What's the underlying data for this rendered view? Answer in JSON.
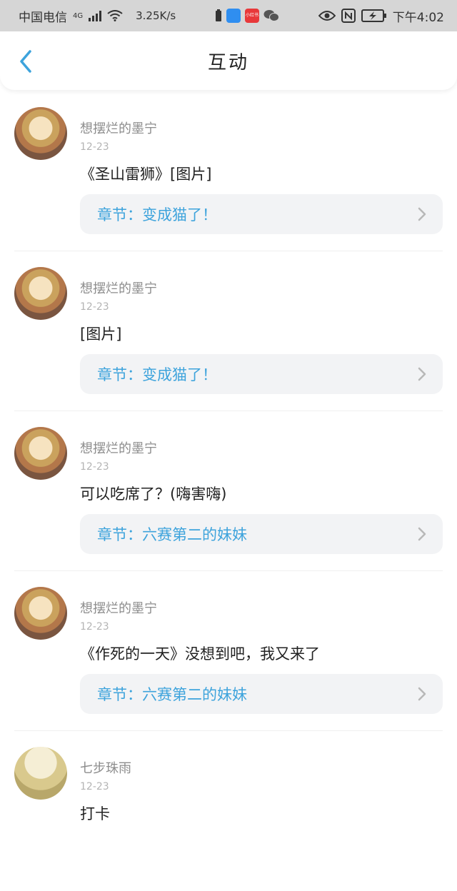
{
  "status_bar": {
    "carrier": "中国电信",
    "network": "4G",
    "speed": "3.25K/s",
    "app_badge": "小红书",
    "time": "下午4:02"
  },
  "header": {
    "title": "互动"
  },
  "feed": [
    {
      "user": "想摆烂的墨宁",
      "date": "12-23",
      "text": "《圣山雷狮》[图片]",
      "chapter": "章节：变成猫了！",
      "avatar": "girl"
    },
    {
      "user": "想摆烂的墨宁",
      "date": "12-23",
      "text": "[图片]",
      "chapter": "章节：变成猫了！",
      "avatar": "girl"
    },
    {
      "user": "想摆烂的墨宁",
      "date": "12-23",
      "text": "可以吃席了？(嗨害嗨)",
      "chapter": "章节：六赛第二的妹妹",
      "avatar": "girl"
    },
    {
      "user": "想摆烂的墨宁",
      "date": "12-23",
      "text": "《作死的一天》没想到吧，我又来了",
      "chapter": "章节：六赛第二的妹妹",
      "avatar": "girl"
    },
    {
      "user": "七步珠雨",
      "date": "12-23",
      "text": "打卡",
      "chapter": "",
      "avatar": "tower"
    }
  ],
  "colors": {
    "accent": "#3da3dc",
    "statusbar_bg": "#d6d6d6",
    "chapter_bg": "#f2f3f5"
  }
}
